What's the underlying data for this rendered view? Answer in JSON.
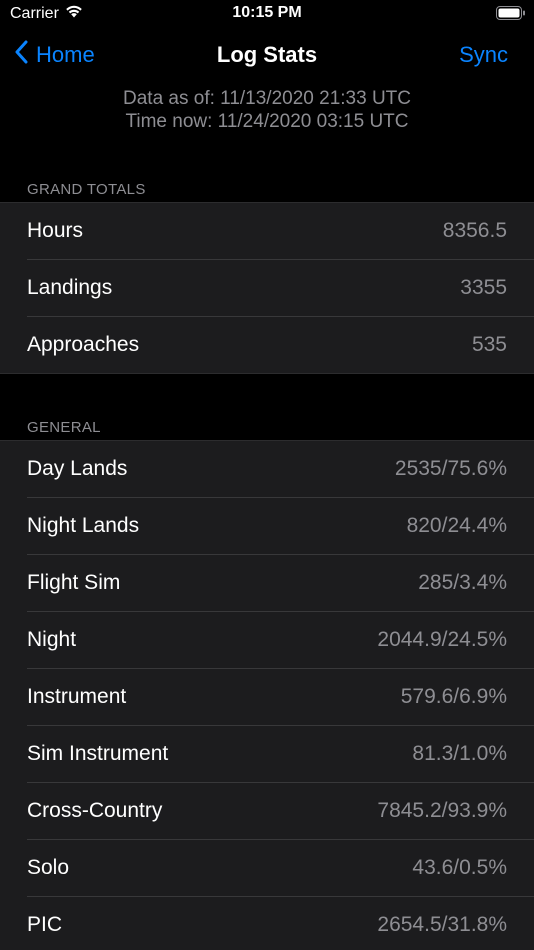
{
  "status_bar": {
    "carrier": "Carrier",
    "time": "10:15 PM"
  },
  "nav": {
    "back_label": "Home",
    "title": "Log Stats",
    "sync_label": "Sync"
  },
  "data_info": {
    "data_as_of": "Data as of: 11/13/2020 21:33 UTC",
    "time_now": "Time now: 11/24/2020 03:15 UTC"
  },
  "grand_totals": {
    "header": "GRAND TOTALS",
    "rows": [
      {
        "label": "Hours",
        "value": "8356.5"
      },
      {
        "label": "Landings",
        "value": "3355"
      },
      {
        "label": "Approaches",
        "value": "535"
      }
    ]
  },
  "general": {
    "header": "GENERAL",
    "rows": [
      {
        "label": "Day Lands",
        "value": "2535/75.6%"
      },
      {
        "label": "Night Lands",
        "value": "820/24.4%"
      },
      {
        "label": "Flight Sim",
        "value": "285/3.4%"
      },
      {
        "label": "Night",
        "value": "2044.9/24.5%"
      },
      {
        "label": "Instrument",
        "value": "579.6/6.9%"
      },
      {
        "label": "Sim Instrument",
        "value": "81.3/1.0%"
      },
      {
        "label": "Cross-Country",
        "value": "7845.2/93.9%"
      },
      {
        "label": "Solo",
        "value": "43.6/0.5%"
      },
      {
        "label": "PIC",
        "value": "2654.5/31.8%"
      }
    ]
  },
  "colors": {
    "accent": "#0a84ff",
    "background": "#000000",
    "cell": "#1c1c1e",
    "secondary_text": "#8e8e93"
  }
}
